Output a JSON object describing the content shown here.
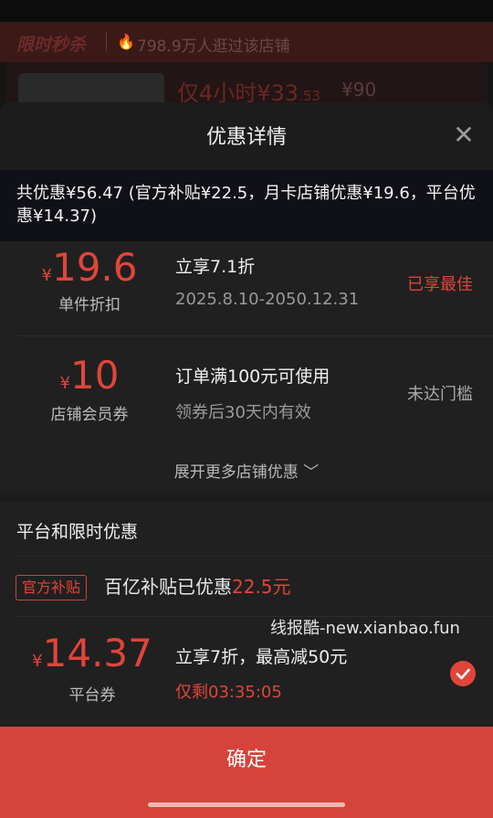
{
  "background": {
    "flash_sale_logo": "限时秒杀",
    "fire_icon": "fire-icon",
    "visits": "798.9万人逛过该店铺",
    "price_prefix": "仅4小时¥33",
    "price_decimal": ".53",
    "original_price": "¥90"
  },
  "sheet": {
    "title": "优惠详情",
    "close_icon": "close-icon"
  },
  "summary": "共优惠¥56.47 (官方补贴¥22.5，月卡店铺优惠¥19.6，平台优惠¥14.37)",
  "store_offers": [
    {
      "currency": "¥",
      "amount": "19.6",
      "label": "单件折扣",
      "title": "立享7.1折",
      "subtitle": "2025.8.10-2050.12.31",
      "status": "已享最佳"
    },
    {
      "currency": "¥",
      "amount": "10",
      "label": "店铺会员券",
      "title": "订单满100元可使用",
      "subtitle": "领券后30天内有效",
      "status": "未达门槛"
    }
  ],
  "expand_label": "展开更多店铺优惠 ﹀",
  "platform": {
    "section_title": "平台和限时优惠",
    "subsidy_badge": "官方补贴",
    "subsidy_text": "百亿补贴已优惠",
    "subsidy_amount": "22.5元",
    "coupon": {
      "currency": "¥",
      "amount": "14.37",
      "label": "平台券",
      "title": "立享7折，最高减50元",
      "countdown": "仅剩03:35:05"
    }
  },
  "watermark": "线报酷-new.xianbao.fun",
  "confirm_label": "确定",
  "colors": {
    "accent": "#e0453a",
    "confirm_bg": "#d6433a",
    "sheet_bg": "#1c1c1c"
  }
}
